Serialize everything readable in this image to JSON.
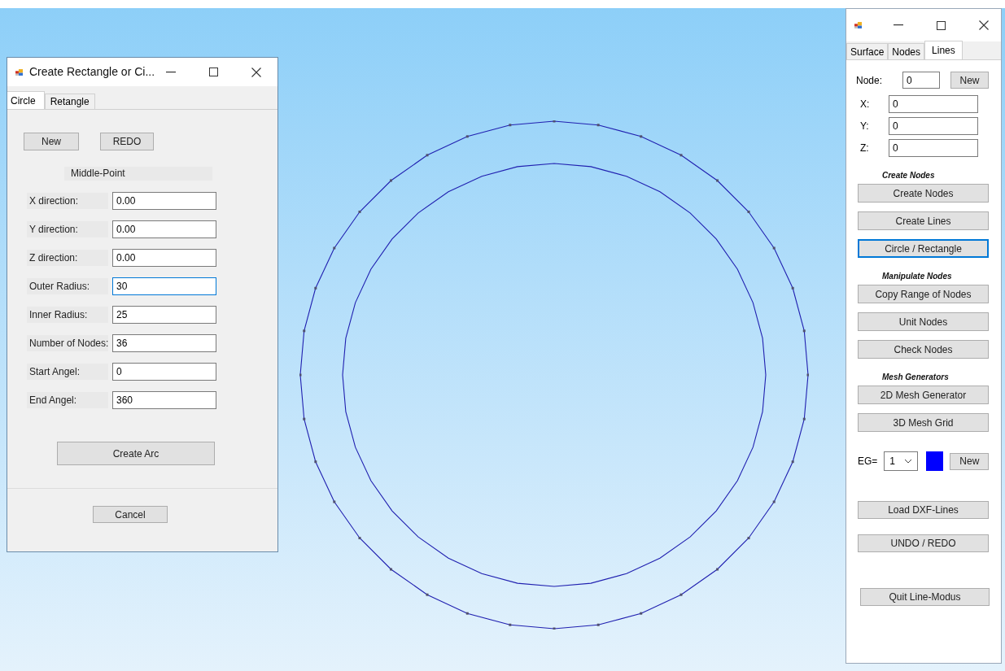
{
  "dialog": {
    "title": "Create Rectangle or Ci...",
    "tabs": [
      {
        "label": "Circle",
        "selected": true
      },
      {
        "label": "Retangle",
        "selected": false
      }
    ],
    "top_buttons": [
      "New",
      "REDO"
    ],
    "section_label": "Middle-Point",
    "fields": [
      {
        "label": "X direction:",
        "value": "0.00",
        "focused": false
      },
      {
        "label": "Y direction:",
        "value": "0.00",
        "focused": false
      },
      {
        "label": "Z direction:",
        "value": "0.00",
        "focused": false
      },
      {
        "label": "Outer Radius:",
        "value": "30",
        "focused": true
      },
      {
        "label": "Inner Radius:",
        "value": "25",
        "focused": false
      },
      {
        "label": "Number of Nodes:",
        "value": "36",
        "focused": false
      },
      {
        "label": "Start Angel:",
        "value": "0",
        "focused": false
      },
      {
        "label": "End Angel:",
        "value": "360",
        "focused": false
      }
    ],
    "create_button": "Create Arc",
    "cancel_button": "Cancel"
  },
  "panel": {
    "tabs": [
      {
        "label": "Surface",
        "selected": false
      },
      {
        "label": "Nodes",
        "selected": false
      },
      {
        "label": "Lines",
        "selected": true
      }
    ],
    "node": {
      "label": "Node:",
      "value": "0",
      "button": "New"
    },
    "coords": [
      {
        "label": "X:",
        "value": "0"
      },
      {
        "label": "Y:",
        "value": "0"
      },
      {
        "label": "Z:",
        "value": "0"
      }
    ],
    "groups": [
      {
        "heading": "Create Nodes",
        "buttons": [
          {
            "label": "Create Nodes",
            "focused": false
          },
          {
            "label": "Create Lines",
            "focused": false
          },
          {
            "label": "Circle / Rectangle",
            "focused": true
          }
        ]
      },
      {
        "heading": "Manipulate Nodes",
        "buttons": [
          {
            "label": "Copy Range of Nodes",
            "focused": false
          },
          {
            "label": "Unit Nodes",
            "focused": false
          },
          {
            "label": "Check Nodes",
            "focused": false
          }
        ]
      },
      {
        "heading": "Mesh Generators",
        "buttons": [
          {
            "label": "2D Mesh Generator",
            "focused": false
          },
          {
            "label": "3D Mesh Grid",
            "focused": false
          }
        ]
      }
    ],
    "eg": {
      "label": "EG=",
      "value": "1",
      "color": "#0000ff",
      "button": "New"
    },
    "bottom_buttons": [
      "Load DXF-Lines",
      "UNDO / REDO"
    ],
    "quit_button": "Quit Line-Modus"
  }
}
